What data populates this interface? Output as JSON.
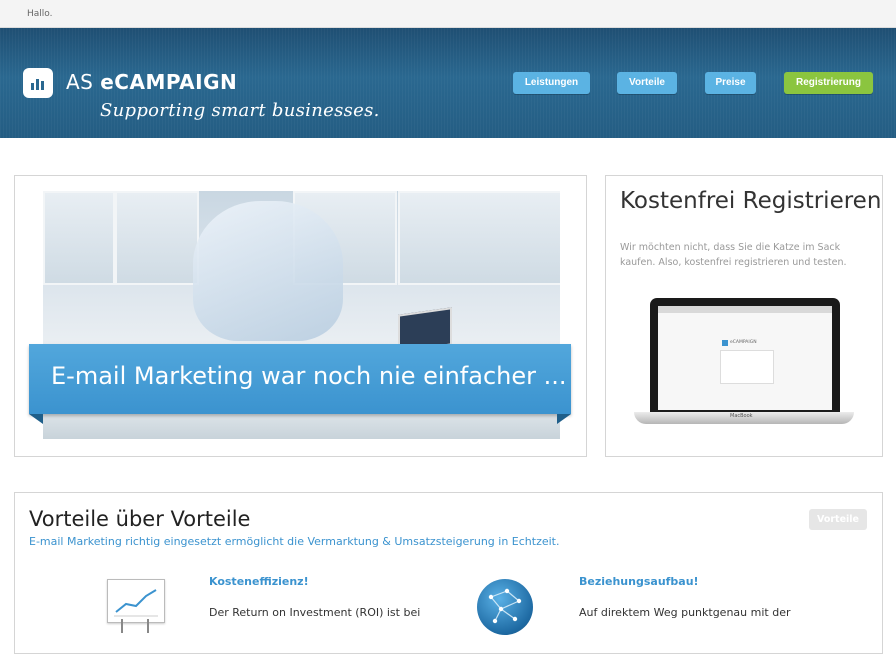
{
  "topbar": {
    "text": "Hallo."
  },
  "header": {
    "brand_prefix": "AS ",
    "brand_name": "eCAMPAIGN",
    "tagline": "Supporting smart businesses.",
    "nav": [
      {
        "label": "Leistungen"
      },
      {
        "label": "Vorteile"
      },
      {
        "label": "Preise"
      },
      {
        "label": "Registrierung"
      }
    ]
  },
  "hero": {
    "banner_text": "E-mail Marketing war noch nie einfacher ..."
  },
  "register": {
    "title": "Kostenfrei Registrieren",
    "text": "Wir möchten nicht, dass Sie die Katze im Sack kaufen. Also, kostenfrei registrieren und testen.",
    "screen_brand": "eCAMPAIGN",
    "laptop_label": "MacBook"
  },
  "vorteile": {
    "title": "Vorteile über Vorteile",
    "subtitle": "E-mail Marketing richtig eingesetzt ermöglicht die Vermarktung & Umsatzsteigerung in Echtzeit.",
    "button": "Vorteile",
    "features": [
      {
        "title": "Kosteneffizienz!",
        "text": "Der Return on Investment (ROI) ist bei"
      },
      {
        "title": "Beziehungsaufbau!",
        "text": "Auf direktem Weg punktgenau mit der"
      }
    ]
  },
  "colors": {
    "accent": "#3b93cf",
    "header": "#245d83",
    "nav": "#5bb3e3",
    "register": "#8bc53f"
  }
}
